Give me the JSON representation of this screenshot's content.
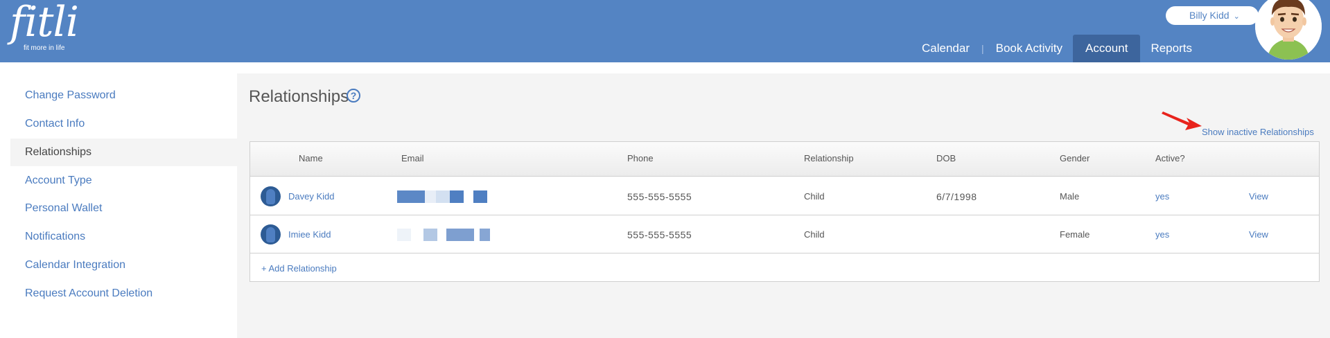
{
  "brand": {
    "logo_text": "fitli",
    "tagline": "fit more in life"
  },
  "user": {
    "name": "Billy Kidd",
    "chevron_glyph": "⌄"
  },
  "nav": {
    "items": [
      {
        "label": "Calendar"
      },
      {
        "label": "Book Activity"
      },
      {
        "label": "Account",
        "active": true
      },
      {
        "label": "Reports"
      }
    ],
    "separator": "|"
  },
  "sidebar": {
    "items": [
      {
        "label": "Change Password"
      },
      {
        "label": "Contact Info"
      },
      {
        "label": "Relationships",
        "active": true
      },
      {
        "label": "Account Type"
      },
      {
        "label": "Personal Wallet"
      },
      {
        "label": "Notifications"
      },
      {
        "label": "Calendar Integration"
      },
      {
        "label": "Request Account Deletion"
      }
    ]
  },
  "page": {
    "title": "Relationships",
    "help_glyph": "?"
  },
  "show_inactive_label": "Show inactive Relationships",
  "table": {
    "columns": [
      "Name",
      "Email",
      "Phone",
      "Relationship",
      "DOB",
      "Gender",
      "Active?"
    ],
    "rows": [
      {
        "name": "Davey Kidd",
        "phone": "555-555-5555",
        "relationship": "Child",
        "dob": "6/7/1998",
        "gender": "Male",
        "active": "yes",
        "action": "View"
      },
      {
        "name": "Imiee Kidd",
        "phone": "555-555-5555",
        "relationship": "Child",
        "dob": "",
        "gender": "Female",
        "active": "yes",
        "action": "View"
      }
    ],
    "add_label": "+ Add Relationship"
  },
  "colors": {
    "header": "#5484c3",
    "nav_active": "#3d659d",
    "link": "#4a7bbf",
    "annotation_arrow": "#e8231c"
  },
  "icons": [
    "help-icon",
    "chevron-down-icon",
    "user-avatar",
    "annotation-arrow"
  ]
}
